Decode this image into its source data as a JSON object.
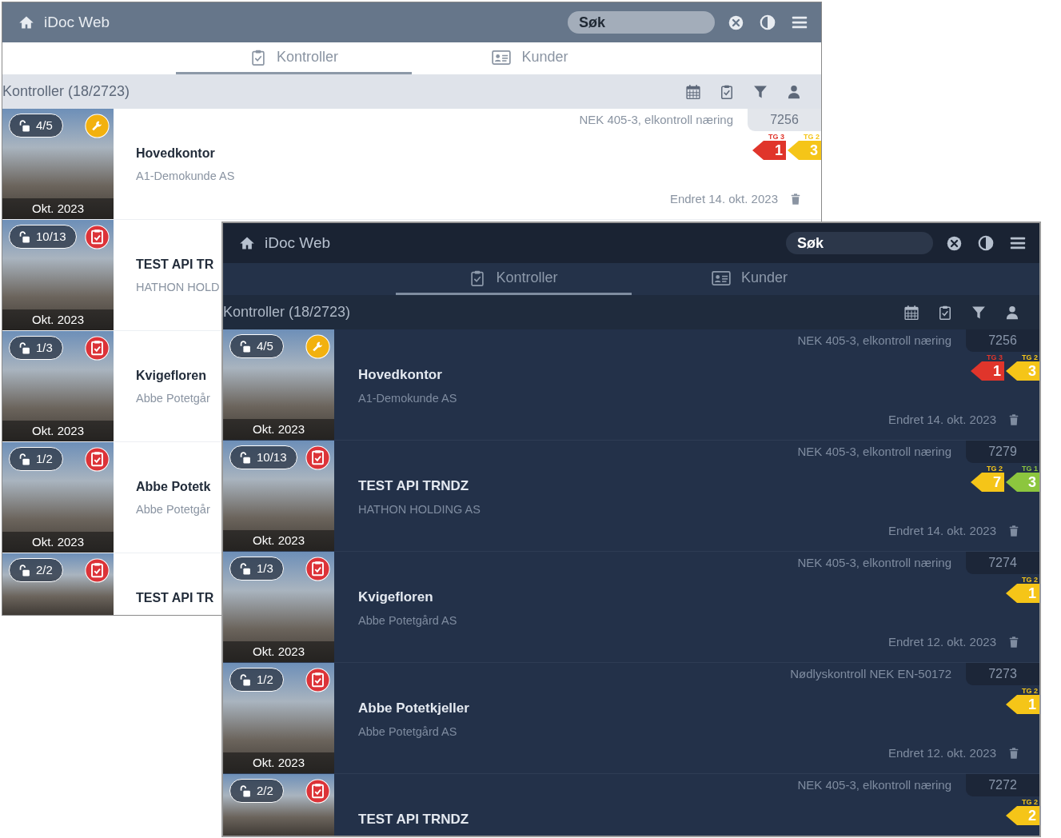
{
  "windows": [
    {
      "title": "iDoc Web",
      "search": {
        "placeholder": "Søk"
      },
      "tabs": [
        {
          "label": "Kontroller",
          "selected": true
        },
        {
          "label": "Kunder",
          "selected": false
        }
      ],
      "list_title": "Kontroller (18/2723)",
      "rows": [
        {
          "progress": "4/5",
          "badge": {
            "kind": "wrench"
          },
          "date_caption": "Okt. 2023",
          "title": "Hovedkontor",
          "subtitle": "A1-Demokunde AS",
          "standard": "NEK 405-3, elkontroll næring",
          "number": "7256",
          "grades": [
            {
              "label": "TG 3",
              "count": "1",
              "color": "#e0352b"
            },
            {
              "label": "TG 2",
              "count": "3",
              "color": "#f5c518"
            }
          ],
          "changed": "Endret 14. okt. 2023"
        },
        {
          "progress": "10/13",
          "badge": {
            "kind": "clipboard"
          },
          "date_caption": "Okt. 2023",
          "title": "TEST API TR",
          "subtitle": "HATHON HOLD"
        },
        {
          "progress": "1/3",
          "badge": {
            "kind": "clipboard"
          },
          "date_caption": "Okt. 2023",
          "title": "Kvigefloren",
          "subtitle": "Abbe Potetgår"
        },
        {
          "progress": "1/2",
          "badge": {
            "kind": "clipboard"
          },
          "date_caption": "Okt. 2023",
          "title": "Abbe Potetk",
          "subtitle": "Abbe Potetgår"
        },
        {
          "progress": "2/2",
          "badge": {
            "kind": "clipboard"
          },
          "title": "TEST API TR"
        }
      ]
    },
    {
      "title": "iDoc Web",
      "search": {
        "placeholder": "Søk"
      },
      "tabs": [
        {
          "label": "Kontroller",
          "selected": true
        },
        {
          "label": "Kunder",
          "selected": false
        }
      ],
      "list_title": "Kontroller (18/2723)",
      "rows": [
        {
          "progress": "4/5",
          "badge": {
            "kind": "wrench"
          },
          "date_caption": "Okt. 2023",
          "title": "Hovedkontor",
          "subtitle": "A1-Demokunde AS",
          "standard": "NEK 405-3, elkontroll næring",
          "number": "7256",
          "grades": [
            {
              "label": "TG 3",
              "count": "1",
              "color": "#e0352b"
            },
            {
              "label": "TG 2",
              "count": "3",
              "color": "#f5c518"
            }
          ],
          "changed": "Endret 14. okt. 2023"
        },
        {
          "progress": "10/13",
          "badge": {
            "kind": "clipboard"
          },
          "date_caption": "Okt. 2023",
          "title": "TEST API TRNDZ",
          "subtitle": "HATHON HOLDING AS",
          "standard": "NEK 405-3, elkontroll næring",
          "number": "7279",
          "grades": [
            {
              "label": "TG 2",
              "count": "7",
              "color": "#f5c518"
            },
            {
              "label": "TG 1",
              "count": "3",
              "color": "#8cc63e"
            }
          ],
          "changed": "Endret 14. okt. 2023"
        },
        {
          "progress": "1/3",
          "badge": {
            "kind": "clipboard"
          },
          "date_caption": "Okt. 2023",
          "title": "Kvigefloren",
          "subtitle": "Abbe Potetgård AS",
          "standard": "NEK 405-3, elkontroll næring",
          "number": "7274",
          "grades": [
            {
              "label": "TG 2",
              "count": "1",
              "color": "#f5c518"
            }
          ],
          "changed": "Endret 12. okt. 2023"
        },
        {
          "progress": "1/2",
          "badge": {
            "kind": "clipboard"
          },
          "date_caption": "Okt. 2023",
          "title": "Abbe Potetkjeller",
          "subtitle": "Abbe Potetgård AS",
          "standard": "Nødlyskontroll NEK EN-50172",
          "number": "7273",
          "grades": [
            {
              "label": "TG 2",
              "count": "1",
              "color": "#f5c518"
            }
          ],
          "changed": "Endret 12. okt. 2023"
        },
        {
          "progress": "2/2",
          "badge": {
            "kind": "clipboard"
          },
          "title": "TEST API TRNDZ",
          "standard": "NEK 405-3, elkontroll næring",
          "number": "7272",
          "grades": [
            {
              "label": "TG 2",
              "count": "2",
              "color": "#f5c518"
            }
          ]
        }
      ]
    }
  ]
}
